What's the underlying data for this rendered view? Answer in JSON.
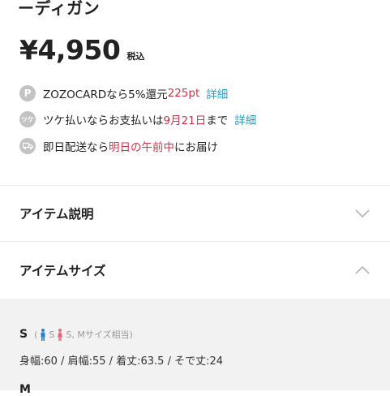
{
  "header": {
    "title_fragment": "ーディガン"
  },
  "price": {
    "amount": "¥4,950",
    "tax_label": "税込"
  },
  "info": {
    "zozocard": {
      "icon": "p-circle-icon",
      "text_prefix": "ZOZOCARDなら5%還元",
      "points": "225pt",
      "link": "詳細"
    },
    "tsuke": {
      "icon": "tsuke-icon",
      "text_prefix": "ツケ払いならお支払いは",
      "date": "9月21日",
      "text_suffix": "まで",
      "link": "詳細"
    },
    "delivery": {
      "icon": "truck-icon",
      "text_prefix": "即日配送なら",
      "highlight": "明日の午前中",
      "text_suffix": "にお届け"
    }
  },
  "accordions": {
    "description": {
      "label": "アイテム説明",
      "state": "collapsed"
    },
    "size": {
      "label": "アイテムサイズ",
      "state": "expanded"
    }
  },
  "sizes": [
    {
      "letter": "S",
      "male_label": "S",
      "female_label": "S, Mサイズ相当",
      "details": "身幅:60 / 肩幅:55 / 着丈:63.5 / そで丈:24"
    },
    {
      "letter": "M"
    }
  ],
  "colors": {
    "accent_red": "#d3324b",
    "link_blue": "#2a9fc0",
    "icon_gray": "#c3c3c3",
    "male_blue": "#2d7ec9",
    "female_pink": "#e06b7f"
  }
}
